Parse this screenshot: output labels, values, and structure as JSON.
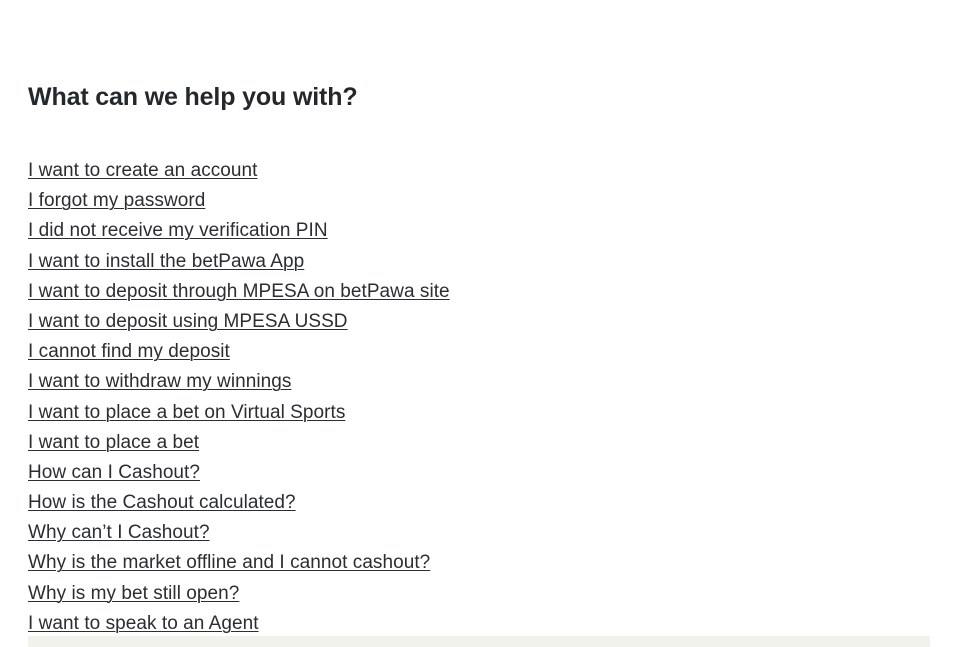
{
  "page": {
    "background_color": "#ffffff",
    "text_color": "#2a2e32",
    "heading_color": "#24282c",
    "band_color": "#f2f2ed"
  },
  "heading": {
    "title": "What can we help you with?"
  },
  "faq": {
    "links": [
      {
        "label": "I want to create an account"
      },
      {
        "label": "I forgot my password"
      },
      {
        "label": "I did not receive my verification PIN"
      },
      {
        "label": "I want to install the betPawa App"
      },
      {
        "label": "I want to deposit through MPESA on betPawa site"
      },
      {
        "label": "I want to deposit using MPESA USSD"
      },
      {
        "label": "I cannot find my deposit"
      },
      {
        "label": "I want to withdraw my winnings"
      },
      {
        "label": "I want to place a bet on Virtual Sports"
      },
      {
        "label": "I want to place a bet"
      },
      {
        "label": "How can I Cashout?"
      },
      {
        "label": "How is the Cashout calculated?"
      },
      {
        "label": "Why can’t I Cashout?"
      },
      {
        "label": "Why is the market offline and I cannot cashout?"
      },
      {
        "label": "Why is my bet still open?"
      },
      {
        "label": "I want to speak to an Agent"
      }
    ]
  }
}
